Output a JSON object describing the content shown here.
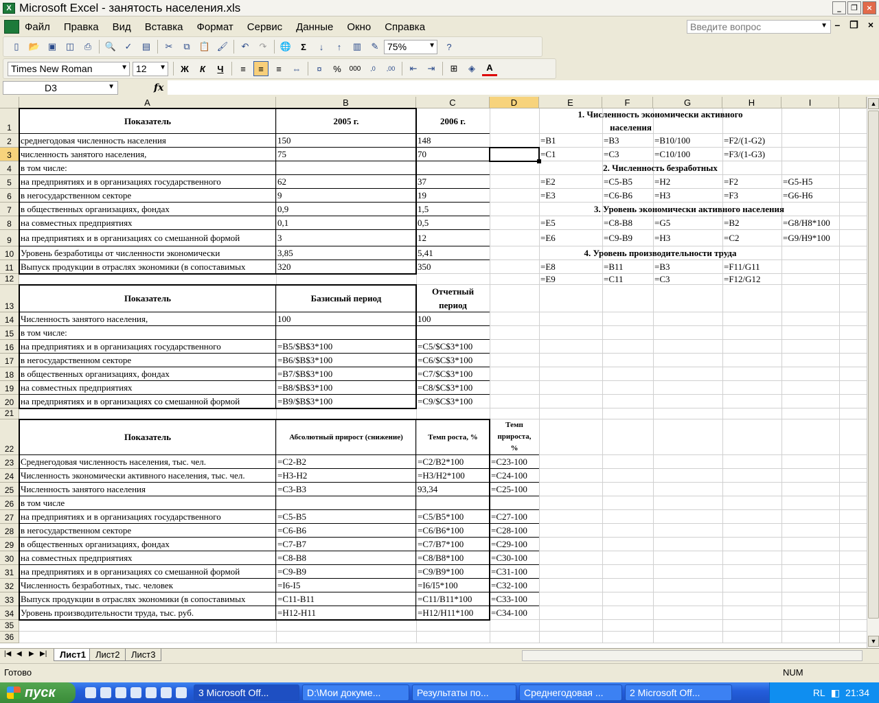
{
  "window": {
    "title": "Microsoft Excel - занятость населения.xls"
  },
  "menu": {
    "items": [
      "Файл",
      "Правка",
      "Вид",
      "Вставка",
      "Формат",
      "Сервис",
      "Данные",
      "Окно",
      "Справка"
    ],
    "help_placeholder": "Введите вопрос"
  },
  "toolbar": {
    "zoom": "75%",
    "font": "Times New Roman",
    "size": "12"
  },
  "formula": {
    "name": "D3",
    "fx": "fx",
    "value": ""
  },
  "columns": [
    "A",
    "B",
    "C",
    "D",
    "E",
    "F",
    "G",
    "H",
    "I"
  ],
  "rows": [
    "1",
    "2",
    "3",
    "4",
    "5",
    "6",
    "7",
    "8",
    "9",
    "10",
    "11",
    "12",
    "13",
    "14",
    "15",
    "16",
    "17",
    "18",
    "19",
    "20",
    "21",
    "22",
    "23",
    "24",
    "25",
    "26",
    "27",
    "28",
    "29",
    "30",
    "31",
    "32",
    "33",
    "34",
    "35",
    "36"
  ],
  "cells": {
    "A1": "Показатель",
    "B1": "2005 г.",
    "C1": "2006 г.",
    "A2": "среднегодовая численность населения",
    "B2": "150",
    "C2": "148",
    "A3": "численность занятого населения,",
    "B3": "75",
    "C3": "70",
    "A4": "в том числе:",
    "A5": "на предприятиях и в организациях государственного",
    "B5": "62",
    "C5": "37",
    "A6": "в негосударственном секторе",
    "B6": "9",
    "C6": "19",
    "A7": "в общественных организациях, фондах",
    "B7": "0,9",
    "C7": "1,5",
    "A8": "на совместных предприятиях",
    "B8": "0,1",
    "C8": "0,5",
    "A9": "на предприятиях и в организациях со смешанной формой",
    "B9": "3",
    "C9": "12",
    "A10": "Уровень безработицы от численности экономически",
    "B10": "3,85",
    "C10": "5,41",
    "A11": "Выпуск продукции в отраслях экономики (в сопоставимых",
    "B11": "320",
    "C11": "350",
    "A13": "Показатель",
    "B13": "Базисный период",
    "C13a": "Отчетный",
    "C13b": "период",
    "A14": "Численность занятого населения,",
    "B14": "100",
    "C14": "100",
    "A15": "в том числе:",
    "A16": "на предприятиях и в организациях государственного",
    "B16": "=B5/$B$3*100",
    "C16": "=C5/$C$3*100",
    "A17": "в негосударственном секторе",
    "B17": "=B6/$B$3*100",
    "C17": "=C6/$C$3*100",
    "A18": "в общественных организациях, фондах",
    "B18": "=B7/$B$3*100",
    "C18": "=C7/$C$3*100",
    "A19": "на совместных предприятиях",
    "B19": "=B8/$B$3*100",
    "C19": "=C8/$C$3*100",
    "A20": "на предприятиях и в организациях со смешанной формой",
    "B20": "=B9/$B$3*100",
    "C20": "=C9/$C$3*100",
    "A22": "Показатель",
    "B22": "Абсолютный прирост (снижение)",
    "C22": "Темп роста, %",
    "D22a": "Темп",
    "D22b": "прироста,",
    "D22c": "%",
    "A23": "Среднегодовая численность населения, тыс. чел.",
    "B23": "=C2-B2",
    "C23": "=C2/B2*100",
    "D23": "=C23-100",
    "A24": "Численность экономически активного населения, тыс. чел.",
    "B24": "=H3-H2",
    "C24": "=H3/H2*100",
    "D24": "=C24-100",
    "A25": "Численность занятого населения",
    "B25": "=C3-B3",
    "C25": "93,34",
    "D25": "=C25-100",
    "A26": "в том числе",
    "A27": "на предприятиях и в организациях государственного",
    "B27": "=C5-B5",
    "C27": "=C5/B5*100",
    "D27": "=C27-100",
    "A28": "в негосударственном секторе",
    "B28": "=C6-B6",
    "C28": "=C6/B6*100",
    "D28": "=C28-100",
    "A29": "в общественных организациях, фондах",
    "B29": "=C7-B7",
    "C29": "=C7/B7*100",
    "D29": "=C29-100",
    "A30": "на совместных предприятиях",
    "B30": "=C8-B8",
    "C30": "=C8/B8*100",
    "D30": "=C30-100",
    "A31": "на предприятиях и в организациях со смешанной формой",
    "B31": "=C9-B9",
    "C31": "=C9/B9*100",
    "D31": "=C31-100",
    "A32": "Численность безработных, тыс. человек",
    "B32": "=I6-I5",
    "C32": "=I6/I5*100",
    "D32": "=C32-100",
    "A33": "Выпуск продукции в отраслях экономики (в сопоставимых",
    "B33": "=C11-B11",
    "C33": "=C11/B11*100",
    "D33": "=C33-100",
    "A34": "Уровень производительности труда, тыс. руб.",
    "B34": "=H12-H11",
    "C34": "=H12/H11*100",
    "D34": "=C34-100",
    "E1a": "1. Численность экономически активного",
    "E1b": "населения",
    "E2": "=B1",
    "F2": "=B3",
    "G2": "=B10/100",
    "H2": "=F2/(1-G2)",
    "E3": "=C1",
    "F3": "=C3",
    "G3": "=C10/100",
    "H3": "=F3/(1-G3)",
    "E4": "2. Численность безработных",
    "E5": "=E2",
    "F5": "=C5-B5",
    "G5": "=H2",
    "H5": "=F2",
    "I5": "=G5-H5",
    "E6": "=E3",
    "F6": "=C6-B6",
    "G6": "=H3",
    "H6": "=F3",
    "I6": "=G6-H6",
    "E7": "3. Уровень экономически активного населения",
    "E8": "=E5",
    "F8": "=C8-B8",
    "G8": "=G5",
    "H8": "=B2",
    "I8": "=G8/H8*100",
    "E9": "=E6",
    "F9": "=C9-B9",
    "G9": "=H3",
    "H9": "=C2",
    "I9": "=G9/H9*100",
    "E10": "4. Уровень производительности труда",
    "E11": "=E8",
    "F11": "=B11",
    "G11": "=B3",
    "H11": "=F11/G11",
    "E12": "=E9",
    "F12": "=C11",
    "G12": "=C3",
    "H12": "=F12/G12"
  },
  "sheets": [
    "Лист1",
    "Лист2",
    "Лист3"
  ],
  "status": {
    "ready": "Готово",
    "num": "NUM"
  },
  "taskbar": {
    "start": "пуск",
    "tasks": [
      "3 Microsoft Off...",
      "D:\\Мои докуме...",
      "Результаты по...",
      "Среднегодовая ...",
      "2 Microsoft Off..."
    ],
    "lang": "RL",
    "time": "21:34"
  }
}
